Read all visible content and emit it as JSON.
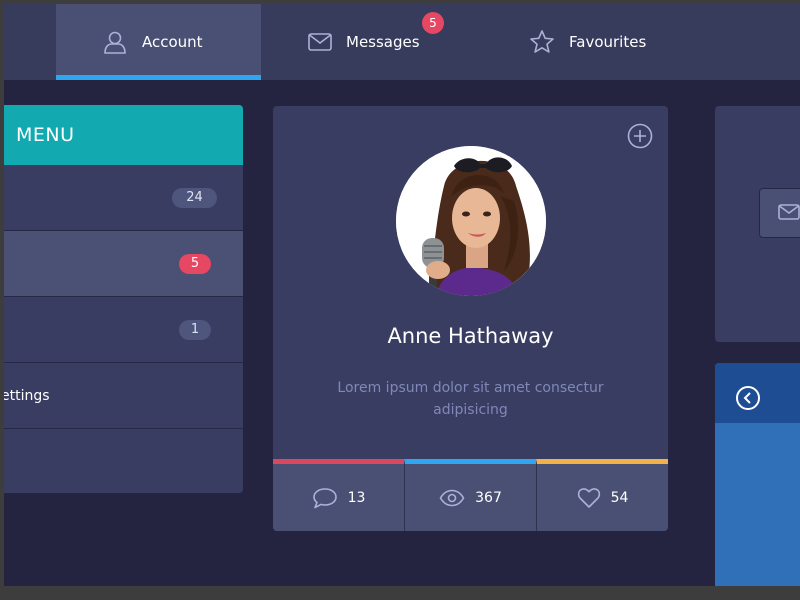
{
  "nav": {
    "tabs": [
      {
        "label": "Account",
        "icon": "user-icon",
        "active": true
      },
      {
        "label": "Messages",
        "icon": "envelope-icon",
        "badge": "5"
      },
      {
        "label": "Favourites",
        "icon": "star-icon"
      }
    ]
  },
  "menu": {
    "title": "MENU",
    "items": [
      {
        "label": "",
        "count": "24"
      },
      {
        "label": "",
        "count": "5",
        "active": true
      },
      {
        "label": "",
        "count": "1"
      },
      {
        "label": "ettings",
        "count": ""
      },
      {
        "label": "",
        "count": ""
      }
    ]
  },
  "profile": {
    "name": "Anne Hathaway",
    "description": "Lorem ipsum dolor sit amet consectur adipisicing",
    "stats": [
      {
        "icon": "comment-icon",
        "value": "13",
        "color": "#d9485e"
      },
      {
        "icon": "eye-icon",
        "value": "367",
        "color": "#30a5f0"
      },
      {
        "icon": "heart-icon",
        "value": "54",
        "color": "#f1b24b"
      }
    ]
  },
  "colors": {
    "background": "#252440",
    "panel": "#393d62",
    "accent_teal": "#12a9b0",
    "accent_blue": "#30a5f0",
    "badge_red": "#e64762"
  }
}
